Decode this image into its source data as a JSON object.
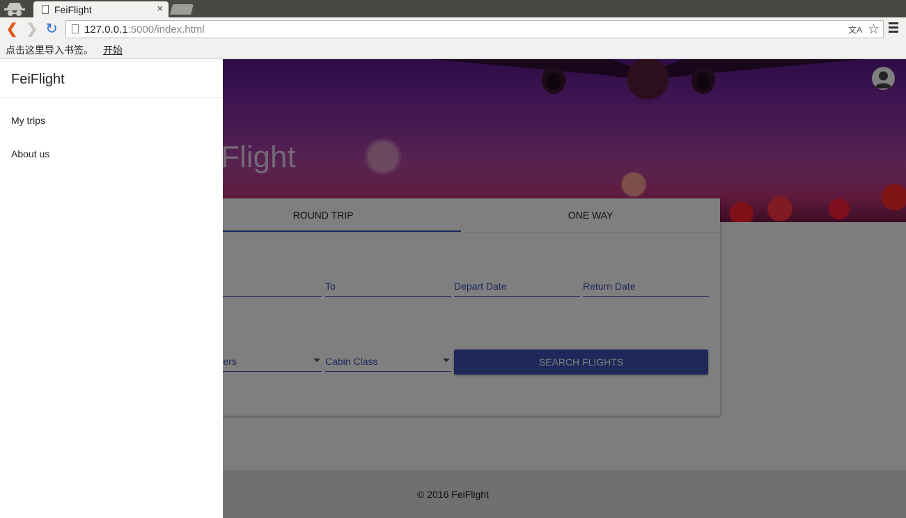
{
  "browser": {
    "tab_title": "FeiFlight",
    "tab_close": "×",
    "url_host": "127.0.0.1",
    "url_rest": ":5000/index.html",
    "bookmarks_hint": "点击这里导入书签。",
    "bookmarks_start": "开始"
  },
  "hero": {
    "title": "FeiFlight"
  },
  "tabs": {
    "round_trip": "ROUND TRIP",
    "one_way": "ONE WAY"
  },
  "form": {
    "to_label": "To",
    "depart_label": "Depart Date",
    "return_label": "Return Date",
    "travelers_label": "Travelers",
    "cabin_label": "Cabin Class",
    "search_label": "SEARCH FLIGHTS"
  },
  "footer": {
    "text": "© 2016 FeiFlight"
  },
  "drawer": {
    "title": "FeiFlight",
    "items": [
      {
        "label": "My trips"
      },
      {
        "label": "About us"
      }
    ]
  },
  "colors": {
    "primary": "#3f51b5",
    "overlay": "rgba(0,0,0,0.5)"
  }
}
